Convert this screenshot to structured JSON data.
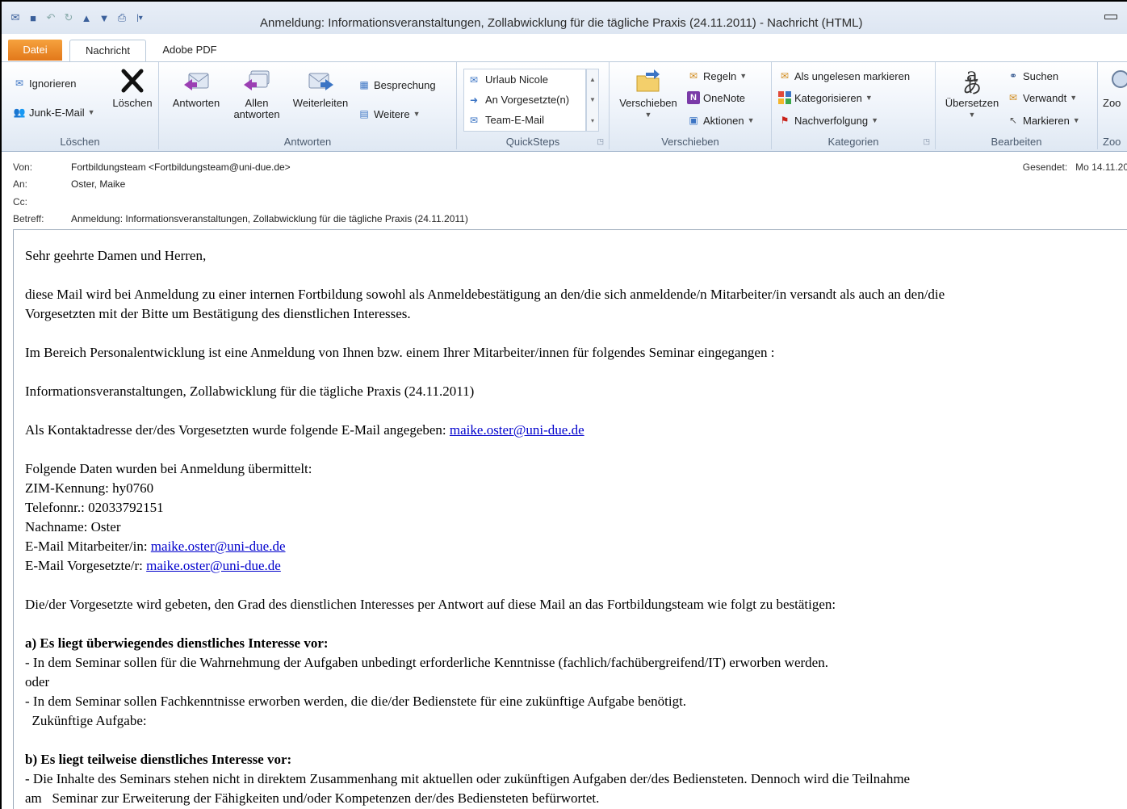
{
  "window": {
    "title": "Anmeldung: Informationsveranstaltungen, Zollabwicklung für die tägliche Praxis (24.11.2011)  -  Nachricht (HTML)"
  },
  "tabs": {
    "file": "Datei",
    "message": "Nachricht",
    "adobe": "Adobe PDF"
  },
  "ribbon": {
    "loeschen": {
      "label": "Löschen",
      "ignore": "Ignorieren",
      "junk": "Junk-E-Mail",
      "delete": "Löschen"
    },
    "antworten": {
      "label": "Antworten",
      "reply": "Antworten",
      "reply_all_1": "Allen",
      "reply_all_2": "antworten",
      "forward": "Weiterleiten",
      "meeting": "Besprechung",
      "more": "Weitere"
    },
    "quicksteps": {
      "label": "QuickSteps",
      "items": [
        "Urlaub Nicole",
        "An Vorgesetzte(n)",
        "Team-E-Mail"
      ]
    },
    "verschieben": {
      "label": "Verschieben",
      "move": "Verschieben",
      "rules": "Regeln",
      "onenote": "OneNote",
      "actions": "Aktionen"
    },
    "kategorien": {
      "label": "Kategorien",
      "unread": "Als ungelesen markieren",
      "categorize": "Kategorisieren",
      "followup": "Nachverfolgung"
    },
    "bearbeiten": {
      "label": "Bearbeiten",
      "translate": "Übersetzen",
      "find": "Suchen",
      "related": "Verwandt",
      "select": "Markieren"
    },
    "zoom": {
      "label": "Zoo",
      "btn": "Zoo"
    }
  },
  "header": {
    "from_label": "Von:",
    "from": "Fortbildungsteam <Fortbildungsteam@uni-due.de>",
    "to_label": "An:",
    "to": "Oster, Maike",
    "cc_label": "Cc:",
    "subject_label": "Betreff:",
    "subject": "Anmeldung: Informationsveranstaltungen, Zollabwicklung für die tägliche Praxis (24.11.2011)",
    "sent_label": "Gesendet:",
    "sent": "Mo 14.11.20"
  },
  "body": {
    "greeting": "Sehr geehrte Damen und Herren,",
    "p1a": "diese Mail wird bei Anmeldung zu einer internen Fortbildung sowohl als Anmeldebestätigung an den/die sich anmeldende/n Mitarbeiter/in versandt als auch an den/die",
    "p1b": "Vorgesetzten mit der Bitte um Bestätigung des dienstlichen Interesses.",
    "p2": "Im Bereich Personalentwicklung ist eine Anmeldung von Ihnen bzw. einem Ihrer Mitarbeiter/innen für folgendes Seminar eingegangen :",
    "p3": "Informationsveranstaltungen, Zollabwicklung für die tägliche Praxis (24.11.2011)",
    "p4": "Als Kontaktadresse der/des Vorgesetzten wurde folgende E-Mail angegeben: ",
    "p4_link": "maike.oster@uni-due.de",
    "data_intro": "Folgende Daten wurden bei Anmeldung übermittelt:",
    "zim": "ZIM-Kennung: hy0760",
    "phone": "Telefonnr.: 02033792151",
    "name": "Nachname: Oster",
    "email_emp_label": "E-Mail Mitarbeiter/in: ",
    "email_emp": "maike.oster@uni-due.de",
    "email_sup_label": "E-Mail Vorgesetzte/r: ",
    "email_sup": "maike.oster@uni-due.de",
    "p5": "Die/der Vorgesetzte wird gebeten, den Grad des dienstlichen Interesses per Antwort auf diese Mail an das Fortbildungsteam wie folgt zu bestätigen:",
    "a_title": "a) Es liegt überwiegendes dienstliches Interesse vor:",
    "a1": "- In dem Seminar sollen für die Wahrnehmung der Aufgaben unbedingt erforderliche Kenntnisse (fachlich/fachübergreifend/IT) erworben werden.",
    "a_or": "oder",
    "a2": "- In dem Seminar sollen Fachkenntnisse erworben werden, die die/der Bedienstete für eine zukünftige Aufgabe benötigt.",
    "a3": "  Zukünftige Aufgabe:",
    "b_title": "b) Es liegt teilweise dienstliches Interesse vor:",
    "b1": "- Die Inhalte des Seminars stehen nicht in direktem Zusammenhang mit aktuellen oder zukünftigen Aufgaben der/des Bediensteten. Dennoch wird die Teilnahme",
    "b2": "am   Seminar zur Erweiterung der Fähigkeiten und/oder Kompetenzen der/des Bediensteten befürwortet."
  }
}
